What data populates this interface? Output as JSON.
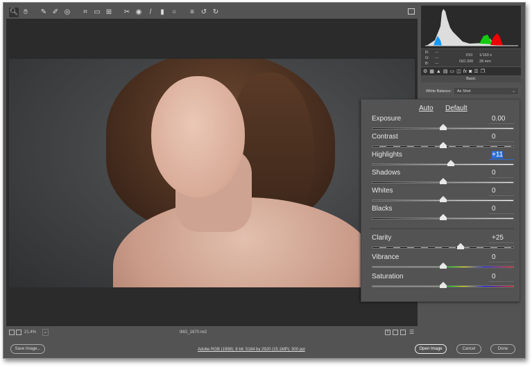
{
  "toolbar": {
    "tools": [
      "zoom-icon",
      "hand-icon",
      "white-balance-icon",
      "color-sampler-icon",
      "target-adjust-icon",
      "crop-icon",
      "straighten-icon",
      "transform-icon",
      "spot-removal-icon",
      "red-eye-icon",
      "adjustment-brush-icon",
      "graduated-filter-icon",
      "radial-filter-icon",
      "presets-list-icon",
      "rotate-left-icon",
      "rotate-right-icon"
    ],
    "fullscreen": "fullscreen-icon"
  },
  "histogram": {
    "rgb": {
      "r_label": "R:",
      "g_label": "G:",
      "b_label": "B:",
      "r": "---",
      "g": "---",
      "b": "---"
    },
    "aperture": "f/10",
    "shutter": "1/160 s",
    "iso": "ISO 200",
    "focal": "28 mm"
  },
  "panel": {
    "section": "Basic",
    "white_balance_label": "White Balance:",
    "white_balance_value": "As Shot",
    "auto": "Auto",
    "default": "Default",
    "sliders": [
      {
        "label": "Exposure",
        "value": "0.00",
        "position": 0.5,
        "style": "dark"
      },
      {
        "label": "Contrast",
        "value": "0",
        "position": 0.5,
        "style": "dashed"
      },
      {
        "label": "Highlights",
        "value": "+11",
        "position": 0.555,
        "style": "light",
        "selected": true
      },
      {
        "label": "Shadows",
        "value": "0",
        "position": 0.5,
        "style": "dark"
      },
      {
        "label": "Whites",
        "value": "0",
        "position": 0.5,
        "style": "light"
      },
      {
        "label": "Blacks",
        "value": "0",
        "position": 0.5,
        "style": "dark"
      },
      {
        "label": "Clarity",
        "value": "+25",
        "position": 0.625,
        "style": "dashed"
      },
      {
        "label": "Vibrance",
        "value": "0",
        "position": 0.5,
        "style": "spectrum"
      },
      {
        "label": "Saturation",
        "value": "0",
        "position": 0.5,
        "style": "spectrum"
      }
    ]
  },
  "status": {
    "zoom": "21.4%",
    "filename": "IMG_1670.rw2"
  },
  "footer": {
    "save": "Save Image...",
    "info": "Adobe RGB (1998); 8 bit; 5184 by 2920 (15.1MP); 300 ppi",
    "open": "Open Image",
    "cancel": "Cancel",
    "done": "Done"
  },
  "colors": {
    "bg": "#535353",
    "selection": "#2a6fd6"
  }
}
